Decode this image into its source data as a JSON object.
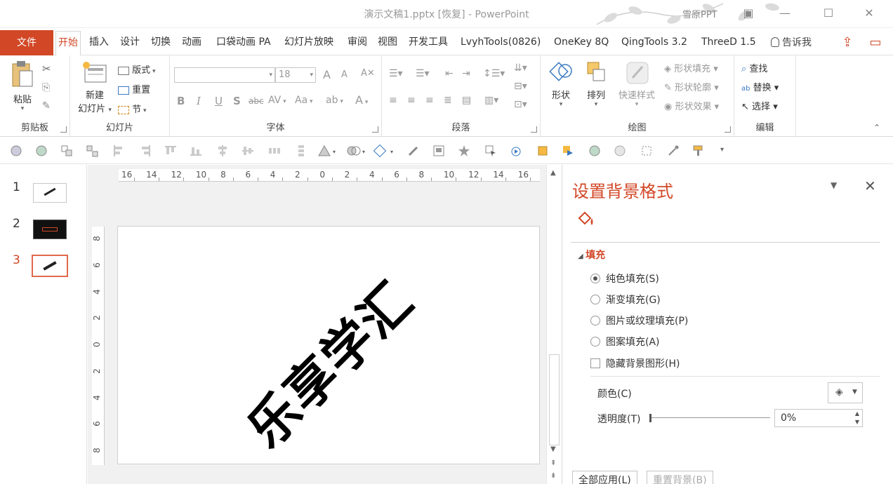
{
  "window": {
    "title": "演示文稿1.pptx [恢复]  -  PowerPoint",
    "user": "雪原PPT"
  },
  "tabs": {
    "file": "文件",
    "items": [
      "开始",
      "插入",
      "设计",
      "切换",
      "动画",
      "口袋动画 PA",
      "幻灯片放映",
      "审阅",
      "视图",
      "开发工具",
      "LvyhTools(0826)",
      "OneKey 8Q",
      "QingTools 3.2",
      "ThreeD 1.5"
    ],
    "active": "开始",
    "tell_me": "告诉我"
  },
  "ribbon": {
    "clipboard": {
      "label": "剪贴板",
      "paste": "粘贴"
    },
    "slides": {
      "label": "幻灯片",
      "new_slide_1": "新建",
      "new_slide_2": "幻灯片",
      "layout": "版式",
      "reset": "重置",
      "section": "节"
    },
    "font": {
      "label": "字体",
      "size": "18",
      "bold": "B",
      "italic": "I",
      "underline": "U",
      "shadow": "S",
      "strike": "abc",
      "spacing": "AV",
      "case": "Aa",
      "grow": "A",
      "shrink": "A"
    },
    "paragraph": {
      "label": "段落"
    },
    "drawing": {
      "label": "绘图",
      "shapes": "形状",
      "arrange": "排列",
      "quick_styles": "快速样式",
      "fill": "形状填充",
      "outline": "形状轮廓",
      "effects": "形状效果"
    },
    "editing": {
      "label": "编辑",
      "find": "查找",
      "replace": "替换",
      "select": "选择"
    }
  },
  "slides_panel": {
    "items": [
      {
        "num": "1"
      },
      {
        "num": "2"
      },
      {
        "num": "3"
      }
    ],
    "selected": "3"
  },
  "slide": {
    "text": "乐享学汇"
  },
  "rulers": {
    "horizontal": [
      "16",
      "14",
      "12",
      "10",
      "8",
      "6",
      "4",
      "2",
      "0",
      "2",
      "4",
      "6",
      "8",
      "10",
      "12",
      "14",
      "16"
    ],
    "vertical": [
      "8",
      "6",
      "4",
      "2",
      "0",
      "2",
      "4",
      "6",
      "8"
    ]
  },
  "format_pane": {
    "title": "设置背景格式",
    "section": "填充",
    "options": {
      "solid": "纯色填充(S)",
      "gradient": "渐变填充(G)",
      "picture": "图片或纹理填充(P)",
      "pattern": "图案填充(A)"
    },
    "selected_option": "solid",
    "hide_bg": "隐藏背景图形(H)",
    "color_label": "颜色(C)",
    "transparency_label": "透明度(T)",
    "transparency_value": "0%",
    "apply_all": "全部应用(L)",
    "reset_bg": "重置背景(B)"
  },
  "colors": {
    "accent": "#d24726"
  }
}
